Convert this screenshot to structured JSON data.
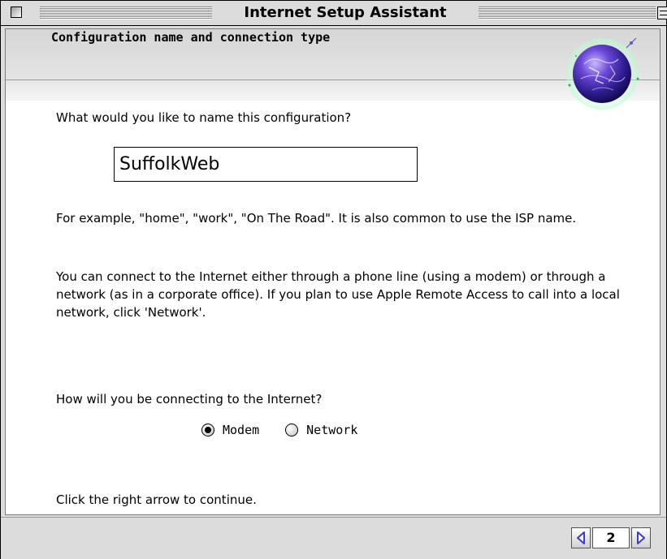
{
  "window": {
    "title": "Internet Setup Assistant"
  },
  "header": {
    "heading": "Configuration name and connection type"
  },
  "form": {
    "name_question": "What would you like to name this configuration?",
    "name_value": "SuffolkWeb",
    "example_text": "For example, \"home\", \"work\", \"On The Road\".  It is also common to use the ISP name.",
    "connect_text": "You can connect to the Internet either through a phone line (using a modem) or through a network (as in a corporate office).  If you plan to use Apple Remote Access to call into a local network, click 'Network'.",
    "connection_question": "How will you be connecting to the Internet?",
    "connection_options": [
      {
        "label": "Modem",
        "selected": true
      },
      {
        "label": "Network",
        "selected": false
      }
    ],
    "continue_text": "Click the right arrow to continue."
  },
  "footer": {
    "page_number": "2",
    "prev_icon": "left-arrow-icon",
    "next_icon": "right-arrow-icon"
  },
  "colors": {
    "chrome": "#dcdcdc",
    "panel": "#ffffff",
    "arrow": "#3a3ad8"
  }
}
